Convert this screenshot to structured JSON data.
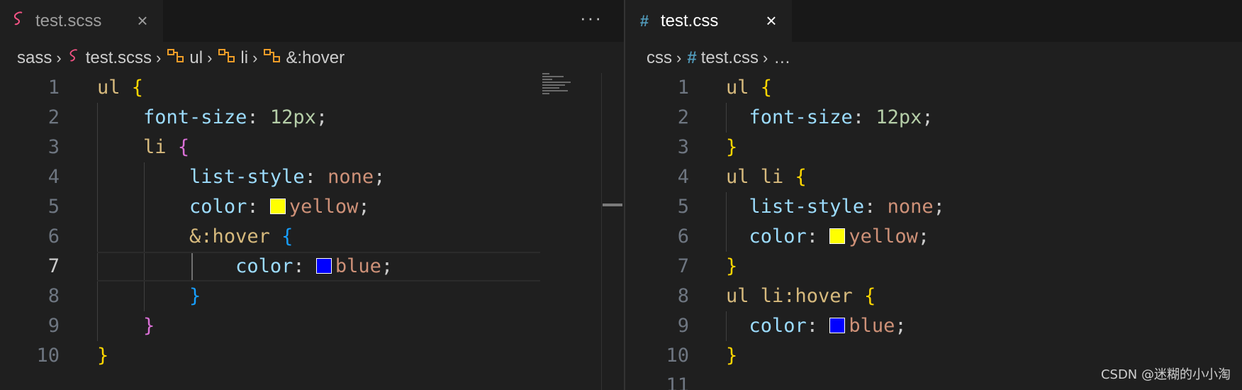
{
  "left_pane": {
    "tab": {
      "icon": "sass-icon",
      "label": "test.scss"
    },
    "more_label": "···",
    "breadcrumb": [
      "sass",
      "test.scss",
      "ul",
      "li",
      "&:hover"
    ]
  },
  "right_pane": {
    "tab": {
      "icon": "#",
      "label": "test.css"
    },
    "breadcrumb": [
      "css",
      "test.css",
      "…"
    ]
  },
  "colors": {
    "yellow_swatch": "#ffff00",
    "blue_swatch": "#0000ff",
    "accent_css": "#519aba",
    "accent_sass": "#f55385"
  },
  "watermark": "CSDN @迷糊的小小淘"
}
